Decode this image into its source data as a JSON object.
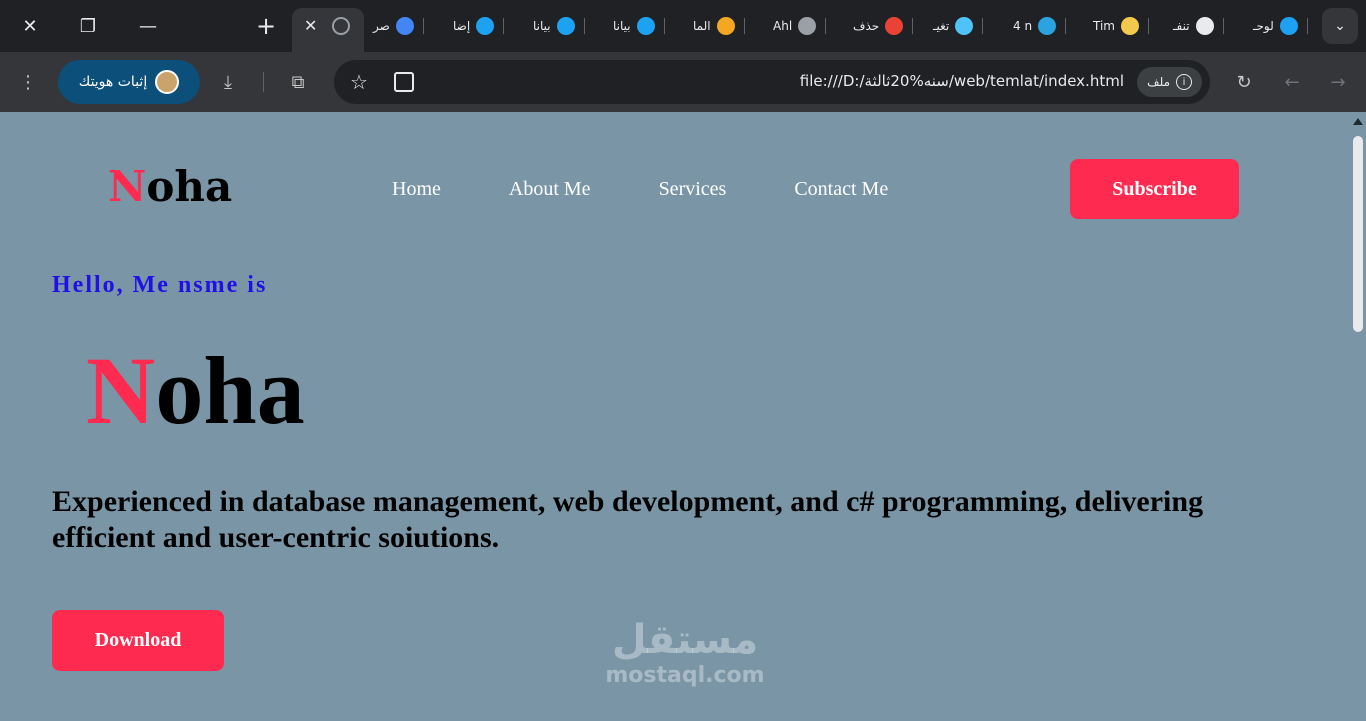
{
  "browser": {
    "tabs": [
      {
        "label": "لوحـ",
        "icon": "circle-icon",
        "color": "#1da1f2"
      },
      {
        "label": "تنفـ",
        "icon": "openai-icon",
        "color": "#e8eaed"
      },
      {
        "label": "Tim",
        "icon": "trello-icon",
        "color": "#f2c94c"
      },
      {
        "label": "4 n",
        "icon": "telegram-icon",
        "color": "#2aa3e0"
      },
      {
        "label": "تغيـ",
        "icon": "c-icon",
        "color": "#4fc3f7"
      },
      {
        "label": "حذف",
        "icon": "gmail-icon",
        "color": "#ea4335"
      },
      {
        "label": "Ahl",
        "icon": "globe-icon",
        "color": "#9aa0a6"
      },
      {
        "label": "الما",
        "icon": "five-icon",
        "color": "#f5a623"
      },
      {
        "label": "بيانا",
        "icon": "circle-icon",
        "color": "#1da1f2"
      },
      {
        "label": "بيانا",
        "icon": "circle-icon",
        "color": "#1da1f2"
      },
      {
        "label": "إضا",
        "icon": "circle-icon",
        "color": "#1da1f2"
      },
      {
        "label": "صر",
        "icon": "google-icon",
        "color": "#4285f4"
      }
    ],
    "profile_label": "إثبات هويتك",
    "url": "file:///D:/سنه%20ثالثة/web/temlat/index.html",
    "site_chip_label": "ملف"
  },
  "page": {
    "logo_initial": "N",
    "logo_rest": "oha",
    "nav": [
      "Home",
      "About Me",
      "Services",
      "Contact Me"
    ],
    "subscribe_label": "Subscribe",
    "greeting": "Hello, Me nsme is",
    "hero_initial": "N",
    "hero_rest": "oha",
    "tagline": "Experienced in database management, web development, and c# programming, delivering efficient and user-centric soiutions.",
    "download_label": "Download",
    "accent_color": "#ff2a4f",
    "background_color": "#7a96a6"
  },
  "watermark": {
    "arabic": "مستقل",
    "latin": "mostaql.com"
  }
}
